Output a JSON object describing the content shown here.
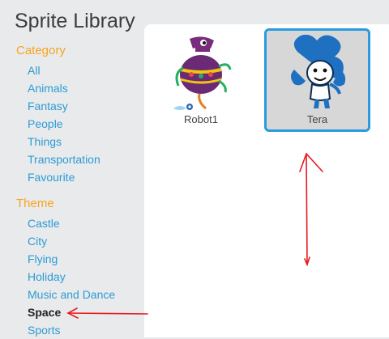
{
  "header": {
    "title": "Sprite Library"
  },
  "category": {
    "heading": "Category",
    "items": [
      {
        "label": "All"
      },
      {
        "label": "Animals"
      },
      {
        "label": "Fantasy"
      },
      {
        "label": "People"
      },
      {
        "label": "Things"
      },
      {
        "label": "Transportation"
      },
      {
        "label": "Favourite"
      }
    ]
  },
  "theme": {
    "heading": "Theme",
    "items": [
      {
        "label": "Castle"
      },
      {
        "label": "City"
      },
      {
        "label": "Flying"
      },
      {
        "label": "Holiday"
      },
      {
        "label": "Music and Dance"
      },
      {
        "label": "Space",
        "selected": true
      },
      {
        "label": "Sports"
      }
    ]
  },
  "sprites": [
    {
      "name": "Robot1",
      "icon": "robot-sprite-icon",
      "selected": false
    },
    {
      "name": "Tera",
      "icon": "tera-sprite-icon",
      "selected": true
    }
  ],
  "colors": {
    "accent": "#2c9bd6",
    "section_heading": "#f5a623",
    "selection_border": "#2b9be0",
    "annotation": "#e8191f"
  }
}
